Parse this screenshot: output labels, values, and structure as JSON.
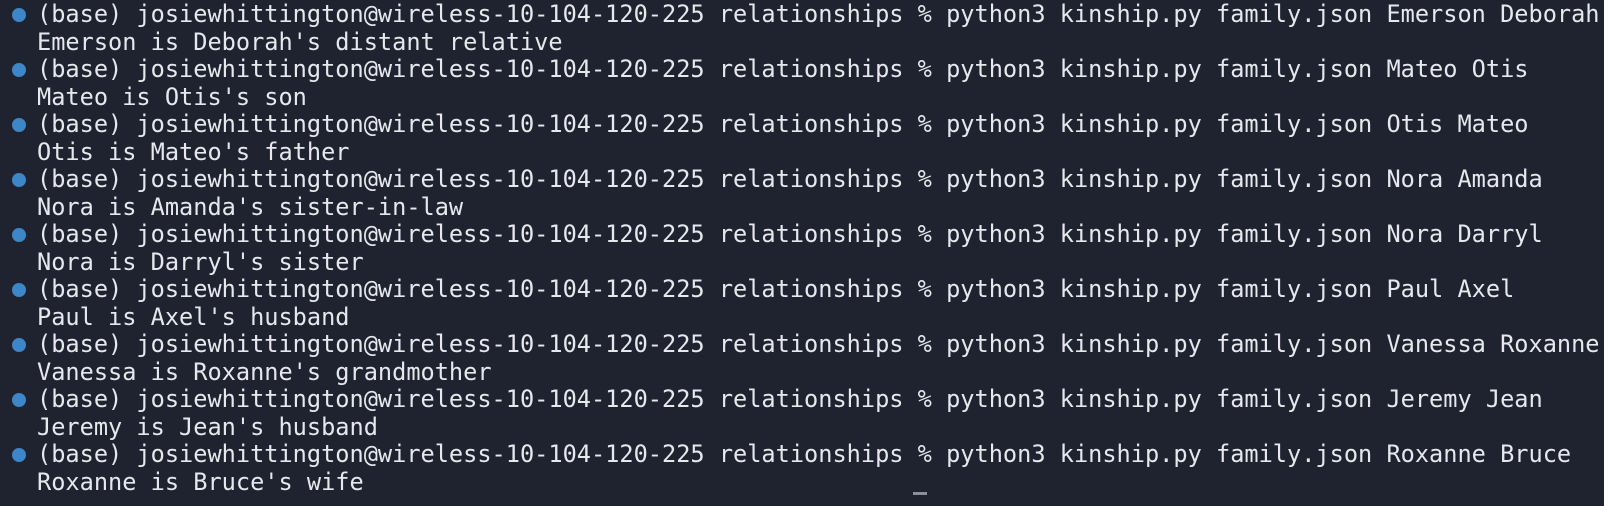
{
  "terminal": {
    "entries": [
      {
        "command": "(base) josiewhittington@wireless-10-104-120-225 relationships % python3 kinship.py family.json Emerson Deborah",
        "output": "Emerson is Deborah's distant relative"
      },
      {
        "command": "(base) josiewhittington@wireless-10-104-120-225 relationships % python3 kinship.py family.json Mateo Otis",
        "output": "Mateo is Otis's son"
      },
      {
        "command": "(base) josiewhittington@wireless-10-104-120-225 relationships % python3 kinship.py family.json Otis Mateo",
        "output": "Otis is Mateo's father"
      },
      {
        "command": "(base) josiewhittington@wireless-10-104-120-225 relationships % python3 kinship.py family.json Nora Amanda",
        "output": "Nora is Amanda's sister-in-law"
      },
      {
        "command": "(base) josiewhittington@wireless-10-104-120-225 relationships % python3 kinship.py family.json Nora Darryl",
        "output": "Nora is Darryl's sister"
      },
      {
        "command": "(base) josiewhittington@wireless-10-104-120-225 relationships % python3 kinship.py family.json Paul Axel",
        "output": "Paul is Axel's husband"
      },
      {
        "command": "(base) josiewhittington@wireless-10-104-120-225 relationships % python3 kinship.py family.json Vanessa Roxanne",
        "output": "Vanessa is Roxanne's grandmother"
      },
      {
        "command": "(base) josiewhittington@wireless-10-104-120-225 relationships % python3 kinship.py family.json Jeremy Jean",
        "output": "Jeremy is Jean's husband"
      },
      {
        "command": "(base) josiewhittington@wireless-10-104-120-225 relationships % python3 kinship.py family.json Roxanne Bruce",
        "output": "Roxanne is Bruce's wife"
      }
    ],
    "colors": {
      "background": "#1f2330",
      "text": "#e6e8ee",
      "prompt_marker": "#3d86c8"
    },
    "icons": {
      "prompt_marker": "command-status-dot-icon",
      "cursor": "text-cursor"
    }
  }
}
